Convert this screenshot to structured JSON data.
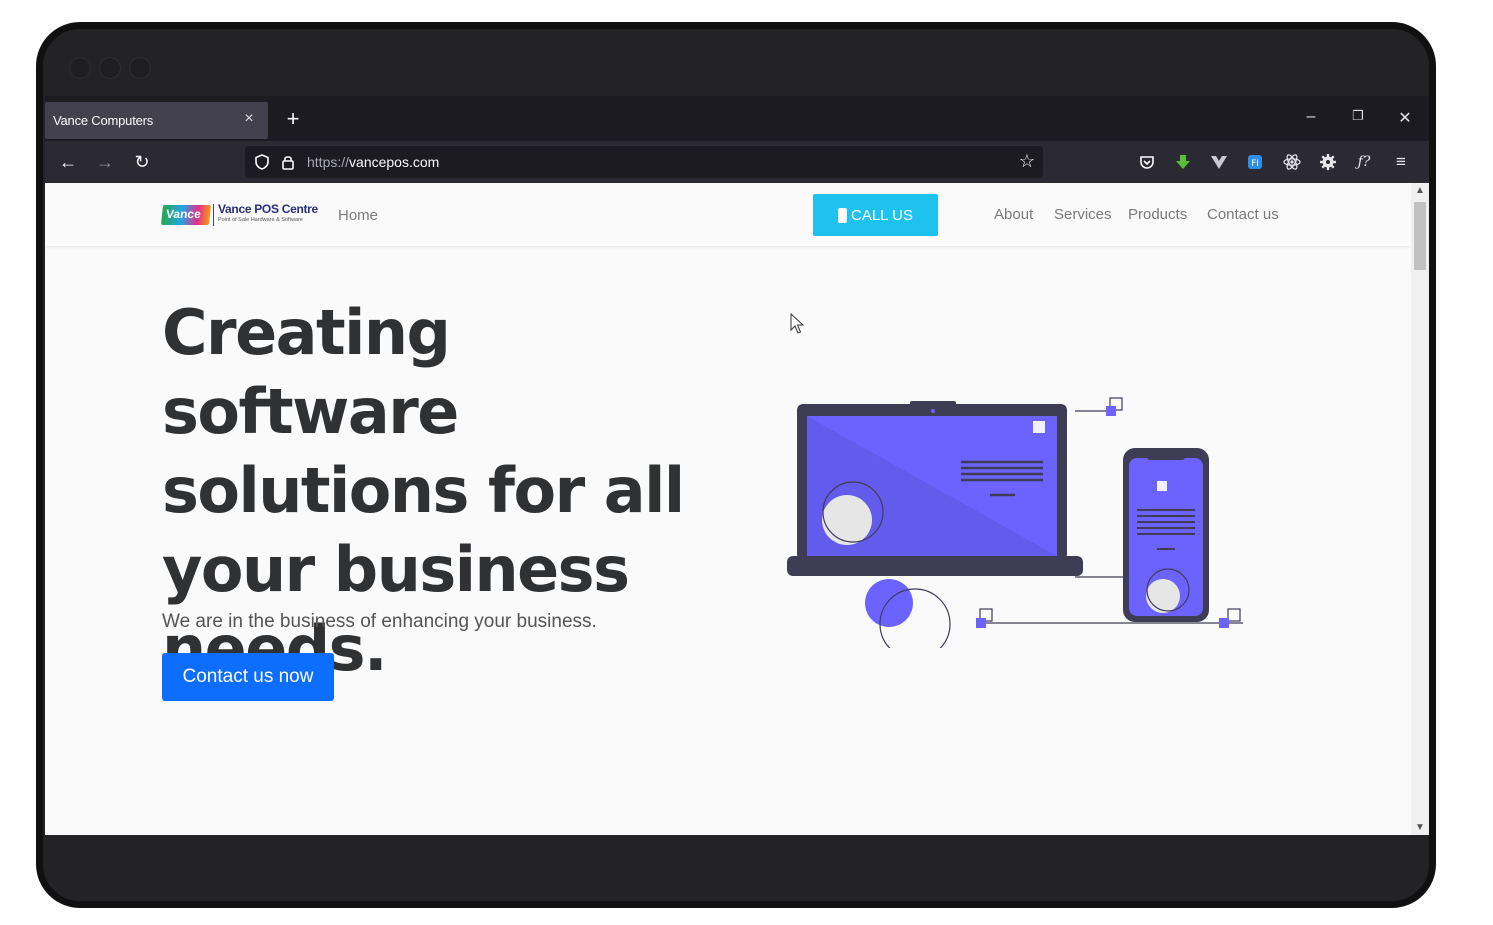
{
  "browser": {
    "tab_title": "Vance Computers",
    "tab_close": "×",
    "new_tab": "+",
    "url_scheme": "https://",
    "url_host": "vancepos.com",
    "window_controls": [
      "–",
      "❐",
      "✕"
    ]
  },
  "site": {
    "logo_badge": "Vance",
    "logo_name": "Vance POS Centre",
    "logo_tagline": "Point of Sale Hardware & Software",
    "nav_home": "Home",
    "call_button": "CALL US",
    "nav_links": [
      "About",
      "Services",
      "Products",
      "Contact us"
    ],
    "hero_title": "Creating software solutions for all your business needs.",
    "hero_subtitle": "We are in the business of enhancing your business.",
    "cta_button": "Contact us now"
  },
  "colors": {
    "accent_call": "#1ec2ef",
    "accent_cta": "#0d6efd",
    "illustration": "#6c63ff",
    "dark_device": "#3f3d56"
  },
  "icons": [
    "back-arrow-icon",
    "forward-arrow-icon",
    "reload-icon",
    "shield-icon",
    "lock-icon",
    "star-icon",
    "pocket-icon",
    "download-icon",
    "vue-icon",
    "extension-icon",
    "react-icon",
    "gear-icon",
    "font-icon",
    "menu-icon"
  ]
}
